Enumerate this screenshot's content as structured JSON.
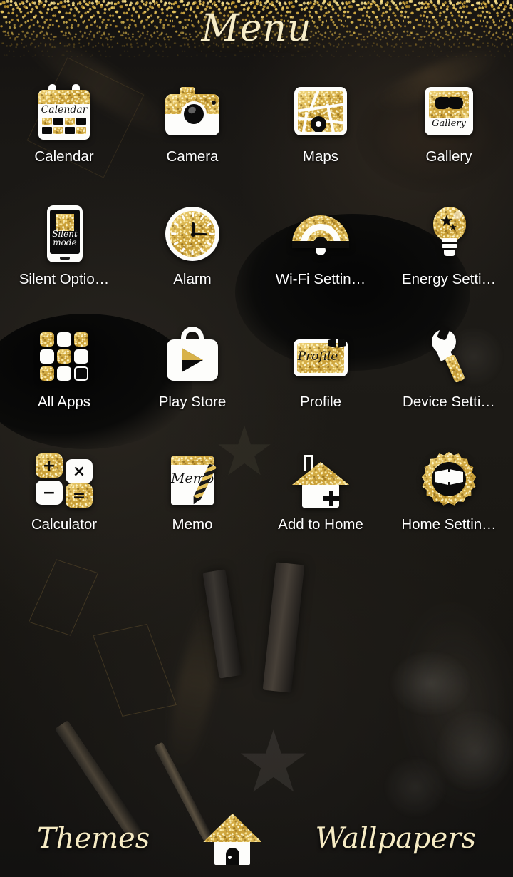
{
  "header": {
    "title": "Menu"
  },
  "theme": {
    "gold": "#d8b24a",
    "gold_light": "#f0d47c",
    "cream": "#f6ebc4",
    "white": "#fdfdfb",
    "black": "#0a0a0a",
    "background": "#0d0c0b",
    "label_color": "#ffffff"
  },
  "apps": [
    {
      "label": "Calendar",
      "icon": "calendar-icon"
    },
    {
      "label": "Camera",
      "icon": "camera-icon"
    },
    {
      "label": "Maps",
      "icon": "maps-icon"
    },
    {
      "label": "Gallery",
      "icon": "gallery-icon"
    },
    {
      "label": "Silent Optio…",
      "icon": "silent-mode-icon"
    },
    {
      "label": "Alarm",
      "icon": "clock-icon"
    },
    {
      "label": "Wi-Fi Settin…",
      "icon": "wifi-icon"
    },
    {
      "label": "Energy Setti…",
      "icon": "lightbulb-icon"
    },
    {
      "label": "All Apps",
      "icon": "app-grid-icon"
    },
    {
      "label": "Play Store",
      "icon": "play-store-icon"
    },
    {
      "label": "Profile",
      "icon": "profile-icon"
    },
    {
      "label": "Device Setti…",
      "icon": "wrench-icon"
    },
    {
      "label": "Calculator",
      "icon": "calculator-icon"
    },
    {
      "label": "Memo",
      "icon": "memo-icon"
    },
    {
      "label": "Add to Home",
      "icon": "add-to-home-icon"
    },
    {
      "label": "Home Settin…",
      "icon": "gear-icon"
    }
  ],
  "icon_text": {
    "calendar_script": "Calendar",
    "gallery_script": "Gallery",
    "silent_script_line1": "Silent",
    "silent_script_line2": "mode",
    "profile_script": "Profile",
    "memo_script": "Memo",
    "calc_add": "+",
    "calc_multiply": "×",
    "calc_subtract": "−",
    "calc_equals": "=",
    "bulb_star_large": "★",
    "bulb_star_small": "★"
  },
  "dock": {
    "themes_label": "Themes",
    "home_label": "Home",
    "wallpapers_label": "Wallpapers"
  }
}
